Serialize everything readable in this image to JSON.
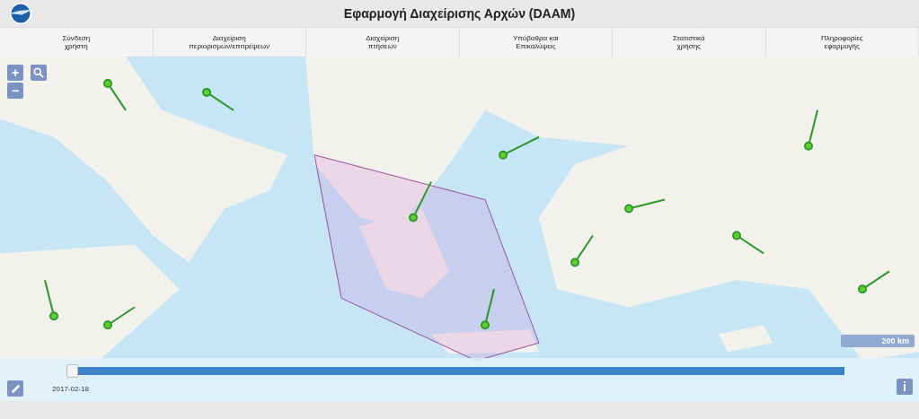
{
  "header": {
    "title": "Εφαρμογή Διαχείρισης Αρχών (DAAM)"
  },
  "nav": [
    {
      "label": "Σύνδεση\nχρήστη"
    },
    {
      "label": "Διαχείριση\nπεριορισμών/επιτρέψεων"
    },
    {
      "label": "Διαχείριση\nπτήσεων"
    },
    {
      "label": "Υπόβαθρα και\nΕπικαλύψεις"
    },
    {
      "label": "Στατιστικά\nχρήσης"
    },
    {
      "label": "Πληροφορίες\nεφαρμογής"
    }
  ],
  "map": {
    "zoom_in": "+",
    "zoom_out": "−",
    "scale": "200 km",
    "info": "i"
  },
  "timeline": {
    "level": 0,
    "date": "2017-02-18"
  }
}
